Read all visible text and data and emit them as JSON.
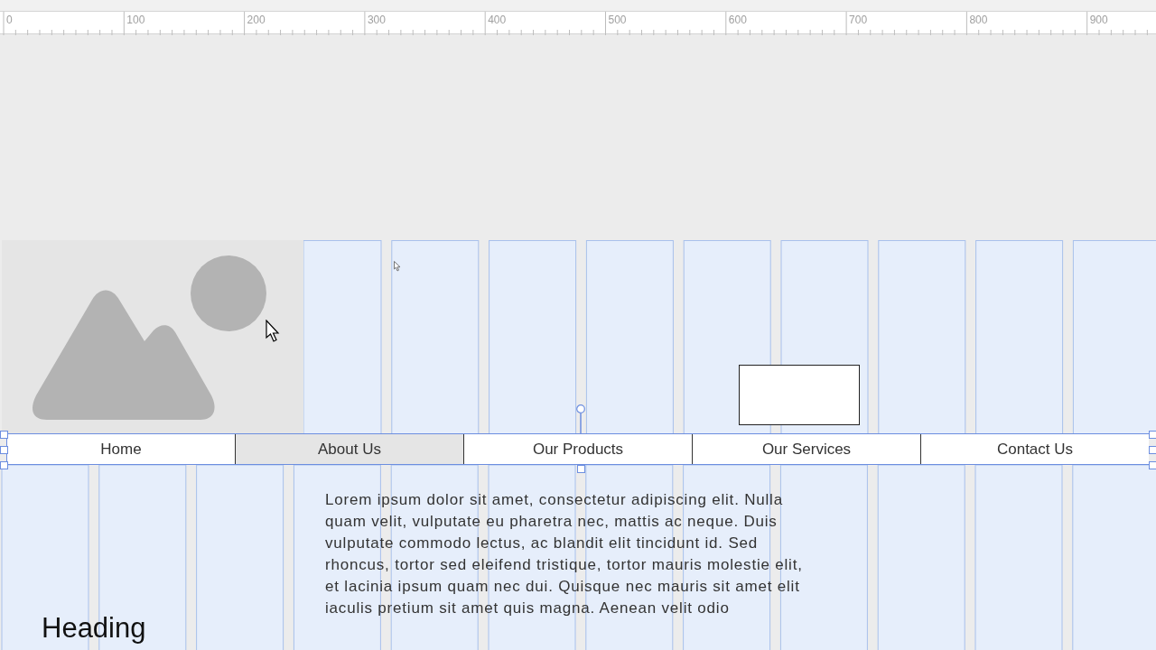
{
  "ruler": {
    "labels": [
      "0",
      "100",
      "200",
      "300",
      "400",
      "500",
      "600",
      "700",
      "800",
      "900"
    ]
  },
  "nav": {
    "selected": true,
    "items": [
      {
        "label": "Home",
        "selected": false
      },
      {
        "label": "About Us",
        "selected": true
      },
      {
        "label": "Our Products",
        "selected": false
      },
      {
        "label": "Our Services",
        "selected": false
      },
      {
        "label": "Contact Us",
        "selected": false
      }
    ]
  },
  "paragraph": "Lorem ipsum dolor sit amet, consectetur adipiscing elit. Nulla quam velit, vulputate eu pharetra nec, mattis ac neque. Duis vulputate commodo lectus, ac blandit elit tincidunt id. Sed rhoncus, tortor sed eleifend tristique, tortor mauris molestie elit, et lacinia ipsum quam nec dui. Quisque nec mauris sit amet elit iaculis pretium sit amet quis magna. Aenean velit odio",
  "heading": "Heading"
}
